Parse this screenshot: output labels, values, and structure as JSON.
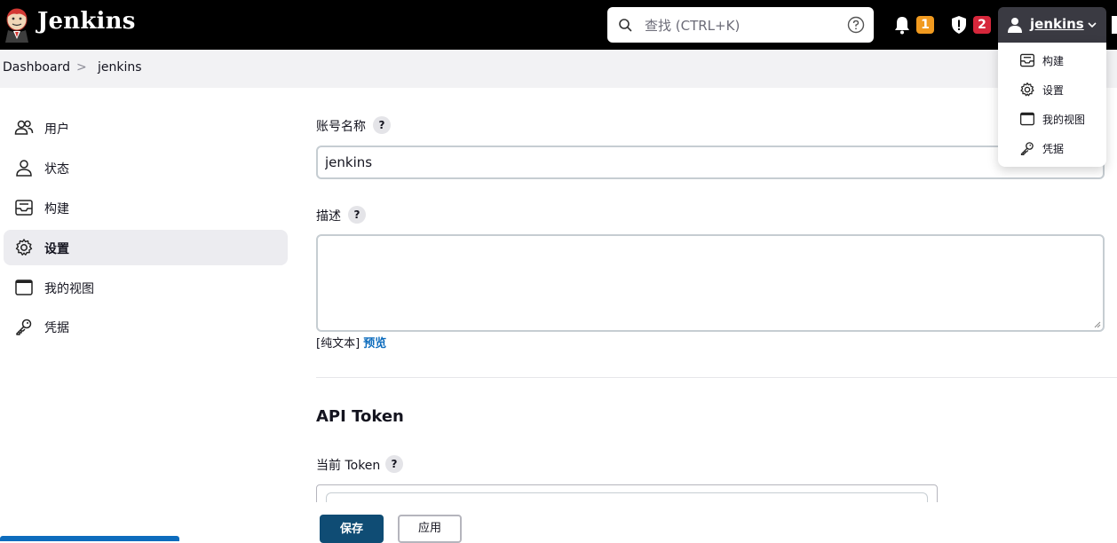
{
  "header": {
    "brand": "Jenkins",
    "search_placeholder": "查找 (CTRL+K)",
    "notifications_count": "1",
    "security_count": "2",
    "username": "jenkins"
  },
  "breadcrumb": {
    "items": [
      "Dashboard",
      "jenkins"
    ],
    "separator": ">"
  },
  "sidebar": {
    "items": [
      {
        "label": "用户",
        "icon": "users-icon"
      },
      {
        "label": "状态",
        "icon": "person-icon"
      },
      {
        "label": "构建",
        "icon": "build-tray-icon"
      },
      {
        "label": "设置",
        "icon": "gear-icon",
        "active": true
      },
      {
        "label": "我的视图",
        "icon": "window-icon"
      },
      {
        "label": "凭据",
        "icon": "key-icon"
      }
    ]
  },
  "form": {
    "account_name_label": "账号名称",
    "account_name_value": "jenkins",
    "description_label": "描述",
    "description_value": "",
    "plain_text": "[纯文本]",
    "preview": "预览",
    "api_token_title": "API Token",
    "current_token_label": "当前 Token",
    "help_glyph": "?"
  },
  "actions": {
    "save": "保存",
    "apply": "应用"
  },
  "user_menu": {
    "items": [
      "构建",
      "设置",
      "我的视图",
      "凭据"
    ]
  },
  "colors": {
    "header_bg": "#000000",
    "badge_orange": "#f19a1f",
    "badge_red": "#d6273b",
    "save_button": "#0f4c74",
    "link": "#0d6cbd"
  }
}
